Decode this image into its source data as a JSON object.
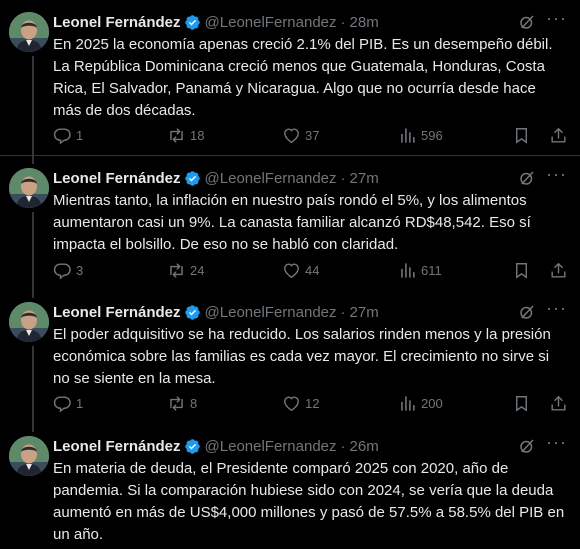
{
  "author": {
    "name": "Leonel Fernández",
    "handle": "@LeonelFernandez"
  },
  "tweets": [
    {
      "time": "28m",
      "text": "En 2025 la economía apenas creció 2.1% del PIB. Es un desempeño débil. La República Dominicana creció menos que Guatemala, Honduras, Costa Rica, El Salvador, Panamá y Nicaragua. Algo que no ocurría desde hace más de dos décadas.",
      "replies": "1",
      "reposts": "18",
      "likes": "37",
      "views": "596"
    },
    {
      "time": "27m",
      "text": "Mientras tanto, la inflación en nuestro país rondó el 5%, y los alimentos aumentaron casi un 9%. La canasta familiar alcanzó RD$48,542. Eso sí impacta el bolsillo. De eso no se habló con claridad.",
      "replies": "3",
      "reposts": "24",
      "likes": "44",
      "views": "611"
    },
    {
      "time": "27m",
      "text": "El poder adquisitivo se ha reducido. Los salarios rinden menos y la presión económica sobre las familias es cada vez mayor. El crecimiento no sirve si no se siente en la mesa.",
      "replies": "1",
      "reposts": "8",
      "likes": "12",
      "views": "200"
    },
    {
      "time": "26m",
      "text": "En materia de deuda, el Presidente comparó 2025 con 2020, año de pandemia. Si la comparación hubiese sido con 2024, se vería que la deuda aumentó en más de US$4,000 millones y pasó de 57.5% a 58.5% del PIB en un año."
    }
  ]
}
